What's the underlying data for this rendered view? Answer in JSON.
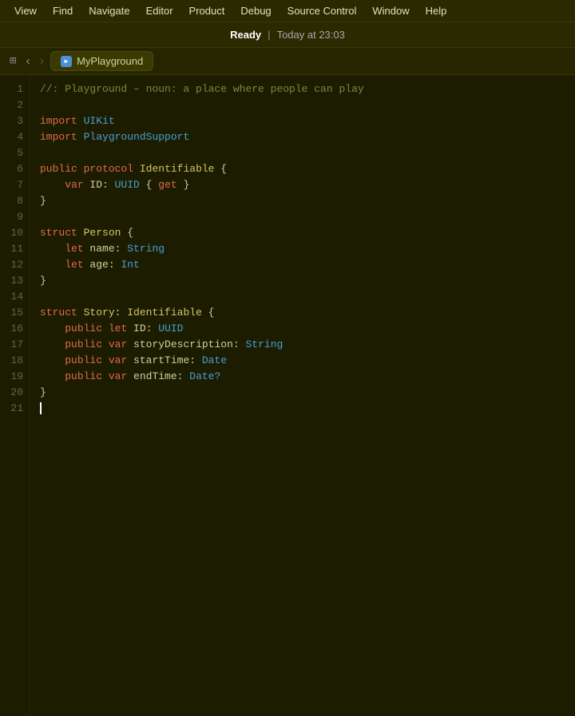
{
  "menubar": {
    "items": [
      "View",
      "Find",
      "Navigate",
      "Editor",
      "Product",
      "Debug",
      "Source Control",
      "Window",
      "Help"
    ]
  },
  "titlebar": {
    "status": "Ready",
    "divider": "|",
    "time": "Today at 23:03"
  },
  "tabbar": {
    "grid_icon": "⊞",
    "back_label": "‹",
    "forward_label": "›",
    "tab_icon": "▶",
    "tab_name": "MyPlayground"
  },
  "editor": {
    "lines": [
      {
        "num": 1,
        "tokens": [
          {
            "cls": "c-comment",
            "text": "//: Playground – noun: a place where people can play"
          }
        ]
      },
      {
        "num": 2,
        "tokens": []
      },
      {
        "num": 3,
        "tokens": [
          {
            "cls": "c-keyword",
            "text": "import"
          },
          {
            "cls": "c-plain",
            "text": " "
          },
          {
            "cls": "c-type",
            "text": "UIKit"
          }
        ]
      },
      {
        "num": 4,
        "tokens": [
          {
            "cls": "c-keyword",
            "text": "import"
          },
          {
            "cls": "c-plain",
            "text": " "
          },
          {
            "cls": "c-type",
            "text": "PlaygroundSupport"
          }
        ]
      },
      {
        "num": 5,
        "tokens": []
      },
      {
        "num": 6,
        "tokens": [
          {
            "cls": "c-keyword",
            "text": "public"
          },
          {
            "cls": "c-plain",
            "text": " "
          },
          {
            "cls": "c-keyword",
            "text": "protocol"
          },
          {
            "cls": "c-plain",
            "text": " "
          },
          {
            "cls": "c-identifier",
            "text": "Identifiable"
          },
          {
            "cls": "c-plain",
            "text": " {"
          }
        ]
      },
      {
        "num": 7,
        "tokens": [
          {
            "cls": "c-plain",
            "text": "    "
          },
          {
            "cls": "c-keyword",
            "text": "var"
          },
          {
            "cls": "c-plain",
            "text": " ID: "
          },
          {
            "cls": "c-type",
            "text": "UUID"
          },
          {
            "cls": "c-plain",
            "text": " { "
          },
          {
            "cls": "c-keyword",
            "text": "get"
          },
          {
            "cls": "c-plain",
            "text": " }"
          }
        ]
      },
      {
        "num": 8,
        "tokens": [
          {
            "cls": "c-plain",
            "text": "}"
          }
        ]
      },
      {
        "num": 9,
        "tokens": []
      },
      {
        "num": 10,
        "tokens": [
          {
            "cls": "c-keyword",
            "text": "struct"
          },
          {
            "cls": "c-plain",
            "text": " "
          },
          {
            "cls": "c-identifier",
            "text": "Person"
          },
          {
            "cls": "c-plain",
            "text": " {"
          }
        ]
      },
      {
        "num": 11,
        "tokens": [
          {
            "cls": "c-plain",
            "text": "    "
          },
          {
            "cls": "c-keyword",
            "text": "let"
          },
          {
            "cls": "c-plain",
            "text": " name: "
          },
          {
            "cls": "c-type",
            "text": "String"
          }
        ]
      },
      {
        "num": 12,
        "tokens": [
          {
            "cls": "c-plain",
            "text": "    "
          },
          {
            "cls": "c-keyword",
            "text": "let"
          },
          {
            "cls": "c-plain",
            "text": " age: "
          },
          {
            "cls": "c-type",
            "text": "Int"
          }
        ]
      },
      {
        "num": 13,
        "tokens": [
          {
            "cls": "c-plain",
            "text": "} "
          },
          {
            "cls": "c-plain",
            "text": "  "
          }
        ]
      },
      {
        "num": 14,
        "tokens": []
      },
      {
        "num": 15,
        "tokens": [
          {
            "cls": "c-keyword",
            "text": "struct"
          },
          {
            "cls": "c-plain",
            "text": " "
          },
          {
            "cls": "c-identifier",
            "text": "Story"
          },
          {
            "cls": "c-plain",
            "text": ": "
          },
          {
            "cls": "c-identifier",
            "text": "Identifiable"
          },
          {
            "cls": "c-plain",
            "text": " {"
          }
        ]
      },
      {
        "num": 16,
        "tokens": [
          {
            "cls": "c-plain",
            "text": "    "
          },
          {
            "cls": "c-keyword",
            "text": "public"
          },
          {
            "cls": "c-plain",
            "text": " "
          },
          {
            "cls": "c-keyword",
            "text": "let"
          },
          {
            "cls": "c-plain",
            "text": " ID: "
          },
          {
            "cls": "c-type",
            "text": "UUID"
          }
        ]
      },
      {
        "num": 17,
        "tokens": [
          {
            "cls": "c-plain",
            "text": "    "
          },
          {
            "cls": "c-keyword",
            "text": "public"
          },
          {
            "cls": "c-plain",
            "text": " "
          },
          {
            "cls": "c-keyword",
            "text": "var"
          },
          {
            "cls": "c-plain",
            "text": " storyDescription: "
          },
          {
            "cls": "c-type",
            "text": "String"
          }
        ]
      },
      {
        "num": 18,
        "tokens": [
          {
            "cls": "c-plain",
            "text": "    "
          },
          {
            "cls": "c-keyword",
            "text": "public"
          },
          {
            "cls": "c-plain",
            "text": " "
          },
          {
            "cls": "c-keyword",
            "text": "var"
          },
          {
            "cls": "c-plain",
            "text": " startTime: "
          },
          {
            "cls": "c-type",
            "text": "Date"
          }
        ]
      },
      {
        "num": 19,
        "tokens": [
          {
            "cls": "c-plain",
            "text": "    "
          },
          {
            "cls": "c-keyword",
            "text": "public"
          },
          {
            "cls": "c-plain",
            "text": " "
          },
          {
            "cls": "c-keyword",
            "text": "var"
          },
          {
            "cls": "c-plain",
            "text": " endTime: "
          },
          {
            "cls": "c-type",
            "text": "Date?"
          }
        ]
      },
      {
        "num": 20,
        "tokens": [
          {
            "cls": "c-plain",
            "text": "}"
          }
        ]
      },
      {
        "num": 21,
        "tokens": [
          {
            "cls": "cursor",
            "text": ""
          }
        ]
      }
    ]
  }
}
